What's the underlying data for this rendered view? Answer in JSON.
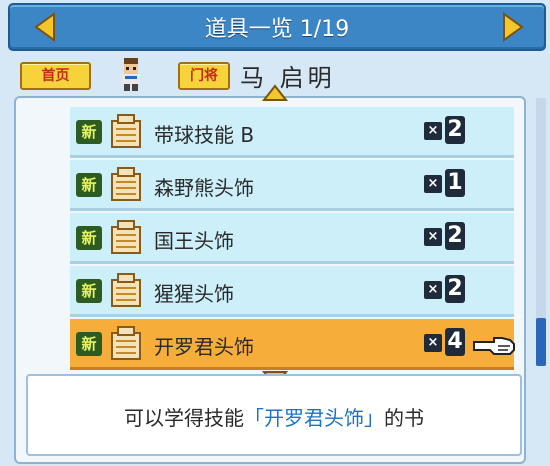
{
  "header": {
    "title": "道具一览",
    "page": "1/19"
  },
  "info": {
    "home_label": "首页",
    "gate_label": "门将",
    "player_name": "马 启明"
  },
  "items": [
    {
      "new_label": "新",
      "name": "带球技能 B",
      "qty": "2"
    },
    {
      "new_label": "新",
      "name": "森野熊头饰",
      "qty": "1"
    },
    {
      "new_label": "新",
      "name": "国王头饰",
      "qty": "2"
    },
    {
      "new_label": "新",
      "name": "猩猩头饰",
      "qty": "2"
    },
    {
      "new_label": "新",
      "name": "开罗君头饰",
      "qty": "4"
    }
  ],
  "selected_index": 4,
  "description": {
    "prefix": "可以学得技能",
    "highlight": "「开罗君头饰」",
    "suffix": "的书"
  },
  "colors": {
    "header_bg": "#3c86c6",
    "row_bg": "#cdeffa",
    "selected_bg": "#f6ad3a",
    "tag_bg": "#f6d23b",
    "tag_text": "#c72a1c",
    "highlight_text": "#1d73c5"
  },
  "icons": {
    "nav_left": "triangle-left-icon",
    "nav_right": "triangle-right-icon",
    "scroll_up": "triangle-up-icon",
    "scroll_down": "triangle-down-icon",
    "item": "book-icon",
    "cursor": "pointing-hand-icon"
  }
}
